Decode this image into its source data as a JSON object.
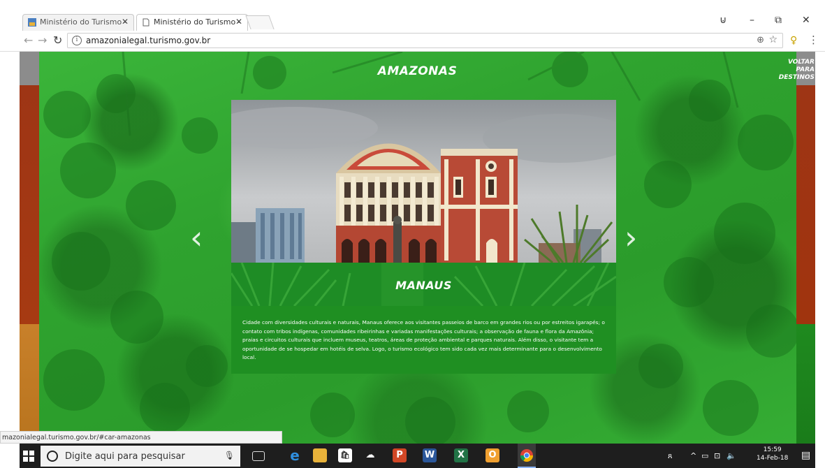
{
  "browser": {
    "tabs": [
      {
        "title": "Ministério do Turismo - ",
        "active": false
      },
      {
        "title": "Ministério do Turismo - ",
        "active": true
      }
    ],
    "url": "amazonialegal.turismo.gov.br"
  },
  "window_controls": {
    "user": "⊍",
    "minimize": "–",
    "restore": "⧉",
    "close": "✕"
  },
  "page": {
    "region_title": "AMAZONAS",
    "back_link": "VOLTAR PARA DESTINOS",
    "prev_arrow": "‹",
    "next_arrow": "›",
    "card": {
      "title": "MANAUS",
      "description": "Cidade com diversidades culturais e naturais, Manaus oferece aos visitantes passeios de barco em grandes rios ou por estreitos igarapés; o contato com tribos indígenas, comunidades ribeirinhas e variadas manifestações culturais; a observação de fauna e flora da Amazônia; praias e circuitos culturais que incluem museus, teatros, áreas de proteção ambiental e parques naturais. Além disso, o visitante tem a oportunidade de se hospedar em hotéis de selva. Logo, o turismo ecológico tem sido cada vez mais determinante para o desenvolvimento local."
    }
  },
  "status_bar": {
    "link": "mazonialegal.turismo.gov.br/#car-amazonas"
  },
  "taskbar": {
    "search_placeholder": "Digite aqui para pesquisar",
    "clock_time": "15:59",
    "clock_date": "14-Feb-18"
  },
  "colors": {
    "page_green": "#2aa52a",
    "card_green": "#1f8f22",
    "taskbar": "#1e1e1e"
  }
}
